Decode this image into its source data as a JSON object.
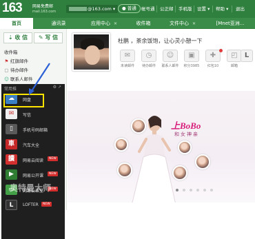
{
  "header": {
    "logo_number": "163",
    "logo_title": "网易免费邮",
    "logo_domain": "mail.163.com",
    "account_suffix": "@163.com ▾",
    "vip_label": "● 普通",
    "links": [
      "帐号通",
      "公正邮",
      "手机版",
      "设置 ▾",
      "帮助 ▾",
      "退出"
    ]
  },
  "nav": {
    "tabs": [
      {
        "label": "首页",
        "active": true
      },
      {
        "label": "通讯录"
      },
      {
        "label": "应用中心",
        "closable": true
      },
      {
        "label": "收件箱"
      },
      {
        "label": "文件中心",
        "closable": true
      },
      {
        "label": "[Mnet亚洲..."
      }
    ]
  },
  "sidebar": {
    "receive_label": "收 信",
    "compose_label": "写 信",
    "folders": [
      {
        "label": "收件箱",
        "icon": "inbox-icon"
      },
      {
        "label": "红旗邮件",
        "icon": "flag-icon"
      },
      {
        "label": "待办邮件",
        "icon": "todo-icon"
      },
      {
        "label": "联系人邮件",
        "icon": "contact-mail-icon"
      }
    ],
    "app_panel": {
      "title": "常用推",
      "controls": "⚙ ↗",
      "apps": [
        {
          "label": "网盘",
          "icon": "cloud-drive-icon",
          "color": "#3b7fc4",
          "highlighted": true
        },
        {
          "label": "写信",
          "icon": "write-letter-icon",
          "color": "#f0f0f0"
        },
        {
          "label": "手机号码邮箱",
          "icon": "mobile-mailbox-icon",
          "color": "#5a5a5a"
        },
        {
          "label": "汽车大全",
          "icon": "car-icon",
          "color": "#c62828"
        },
        {
          "label": "网易云阅读",
          "icon": "cloud-reading-icon",
          "color": "#d32f2f",
          "badge": "NEW"
        },
        {
          "label": "网易公开课",
          "icon": "open-course-icon",
          "color": "#2e7d32",
          "badge": "NEW"
        },
        {
          "label": "网易云课堂",
          "icon": "cloud-classroom-icon",
          "color": "#43a047",
          "badge": "NEW"
        },
        {
          "label": "LOFTER",
          "icon": "lofter-icon",
          "color": "#333333",
          "badge": "NEW"
        }
      ]
    },
    "watermark": "奥特曼大师"
  },
  "main": {
    "greeting": "杜鹏 ，茶余饭饱，让心灵小憩一下",
    "quick_items": [
      {
        "label": "未读邮件",
        "icon": "unread-mail-icon"
      },
      {
        "label": "待办邮件",
        "icon": "todo-mail-icon"
      },
      {
        "label": "联系人邮件",
        "icon": "contact-icon"
      },
      {
        "label": "积分3985",
        "icon": "points-icon"
      },
      {
        "label": "红包10",
        "icon": "red-packet-icon"
      },
      {
        "label": "邮箱",
        "icon": "mailbox-icon"
      },
      {
        "label": "L",
        "icon": "lofter-l-icon"
      }
    ],
    "banner": {
      "headline": "上BoBo",
      "subline": "和女神亲"
    },
    "carousel": {
      "count": 6,
      "active": 0
    }
  }
}
